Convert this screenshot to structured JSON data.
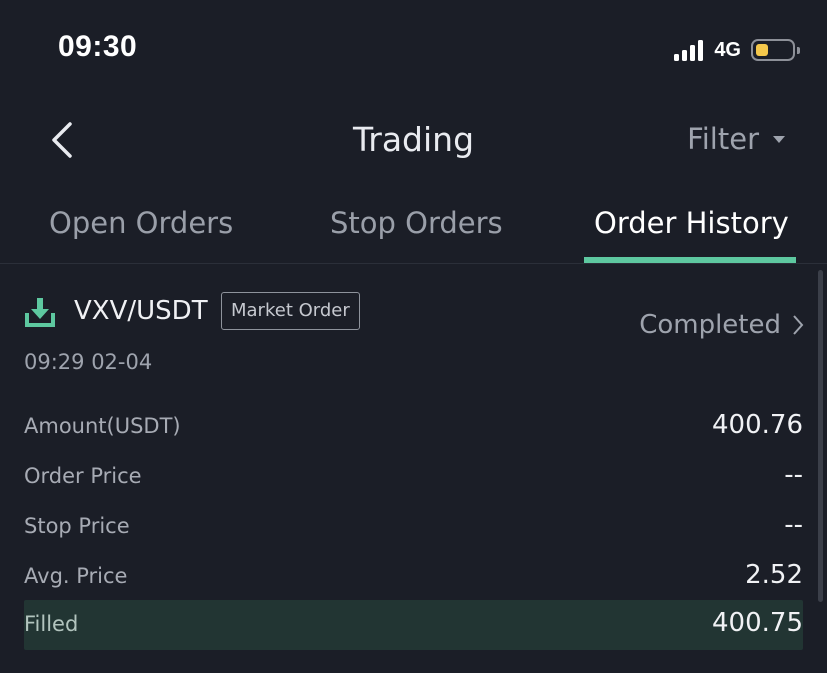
{
  "status_bar": {
    "time": "09:30",
    "network": "4G",
    "battery_level": 0.35,
    "battery_color": "#f5c84c"
  },
  "nav": {
    "title": "Trading",
    "back_icon": "chevron-left-icon",
    "filter_label": "Filter",
    "filter_icon": "caret-down-icon"
  },
  "tabs": [
    {
      "label": "Open Orders",
      "active": false
    },
    {
      "label": "Stop Orders",
      "active": false
    },
    {
      "label": "Order History",
      "active": true
    }
  ],
  "accent_color": "#5ec8a0",
  "order": {
    "icon": "download-icon",
    "pair": "VXV/USDT",
    "type": "Market Order",
    "status": "Completed",
    "time": "09:29 02-04",
    "rows": [
      {
        "label": "Amount(USDT)",
        "value": "400.76"
      },
      {
        "label": "Order Price",
        "value": "--"
      },
      {
        "label": "Stop Price",
        "value": "--"
      },
      {
        "label": "Avg. Price",
        "value": "2.52"
      },
      {
        "label": "Filled",
        "value": "400.75"
      }
    ]
  }
}
